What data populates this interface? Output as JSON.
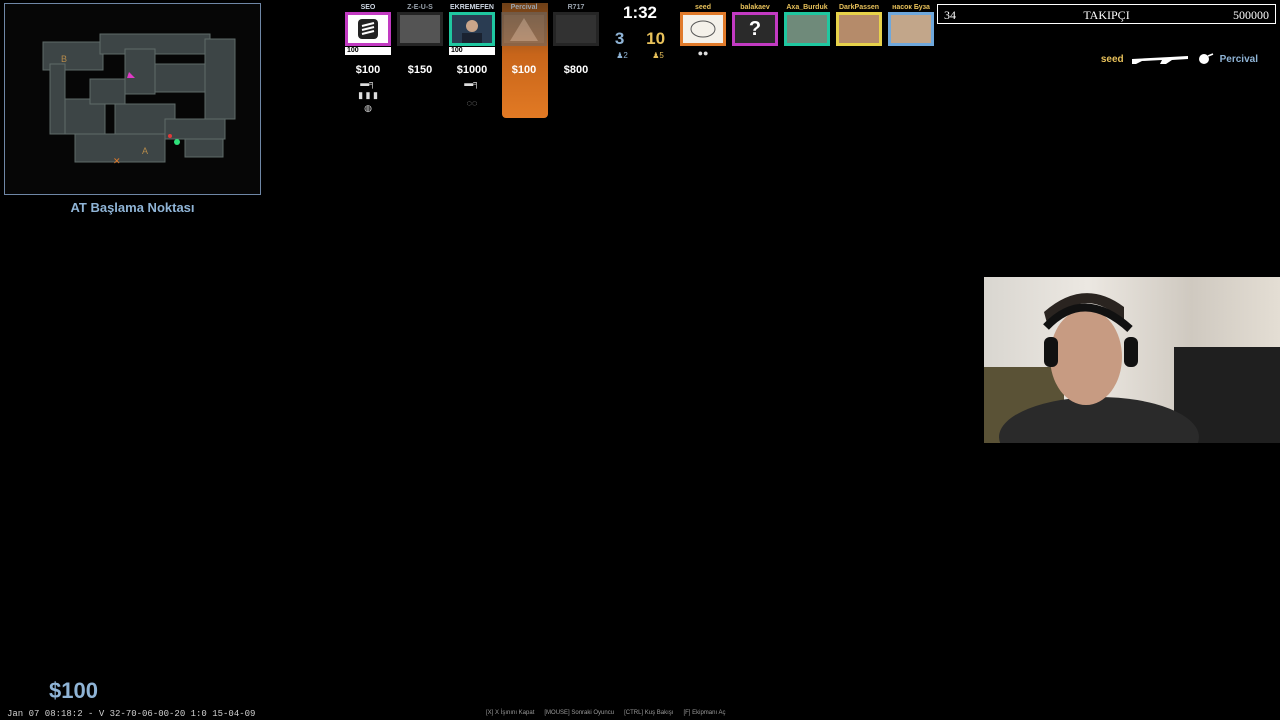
{
  "radar": {
    "caption": "AT Başlama Noktası",
    "labels": {
      "bombsite_b": "B",
      "bombsite_a": "A"
    }
  },
  "ct_team": [
    {
      "name": "SEO",
      "hp": "100",
      "money": "$100",
      "gear": "🔫 ▮▮▮",
      "avatar_color": "#ffffff",
      "border_color": "#c23ac2",
      "dead": false
    },
    {
      "name": "Z-E-U-S",
      "hp": "",
      "money": "$150",
      "gear": "",
      "avatar_color": "#aaaaaa",
      "border_color": "#555555",
      "dead": true
    },
    {
      "name": "EKREMEFEN",
      "hp": "100",
      "money": "$1000",
      "gear": "🔫",
      "avatar_color": "#2a3c52",
      "border_color": "#1fc7a0",
      "dead": false
    },
    {
      "name": "Percival",
      "hp": "",
      "money": "$100",
      "gear": "",
      "avatar_color": "#888888",
      "border_color": "#555555",
      "dead": true,
      "spectated": true
    },
    {
      "name": "R717",
      "hp": "",
      "money": "$800",
      "gear": "",
      "avatar_color": "#666666",
      "border_color": "#555555",
      "dead": true
    }
  ],
  "score": {
    "timer": "1:32",
    "ct": "3",
    "t": "10",
    "ct_alive": "♟2",
    "t_alive": "♟5"
  },
  "t_team": [
    {
      "name": "seed",
      "avatar_color": "#f4f1ea",
      "border_color": "#e07a2a"
    },
    {
      "name": "balakaev",
      "avatar_color": "#2a2a2a",
      "border_color": "#c23ac2",
      "glyph": "?"
    },
    {
      "name": "Axa_Burduk",
      "avatar_color": "#6f8a7a",
      "border_color": "#1fc7a0"
    },
    {
      "name": "DarkPassen",
      "avatar_color": "#b58b6a",
      "border_color": "#e7d24a"
    },
    {
      "name": "насок Буза",
      "avatar_color": "#c2a68a",
      "border_color": "#6fa8dc"
    }
  ],
  "followers": {
    "current": "34",
    "label": "TAKIPÇI",
    "goal": "500000"
  },
  "killfeed": {
    "attacker": "seed",
    "victim": "Percival"
  },
  "money": "$100",
  "bottom_status": "Jan 07 08:18:2 - V 32-70-06-00-20 1:0 15-04-09",
  "hints": [
    "[X] X İşınını Kapat",
    "[MOUSE] Sonraki Oyuncu",
    "[CTRL] Kuş Bakışı",
    "[F] Ekipmanı Aç"
  ],
  "colors": {
    "ct": "#8fb4d6",
    "t": "#e8c15a",
    "spectated": "#e27a24"
  }
}
